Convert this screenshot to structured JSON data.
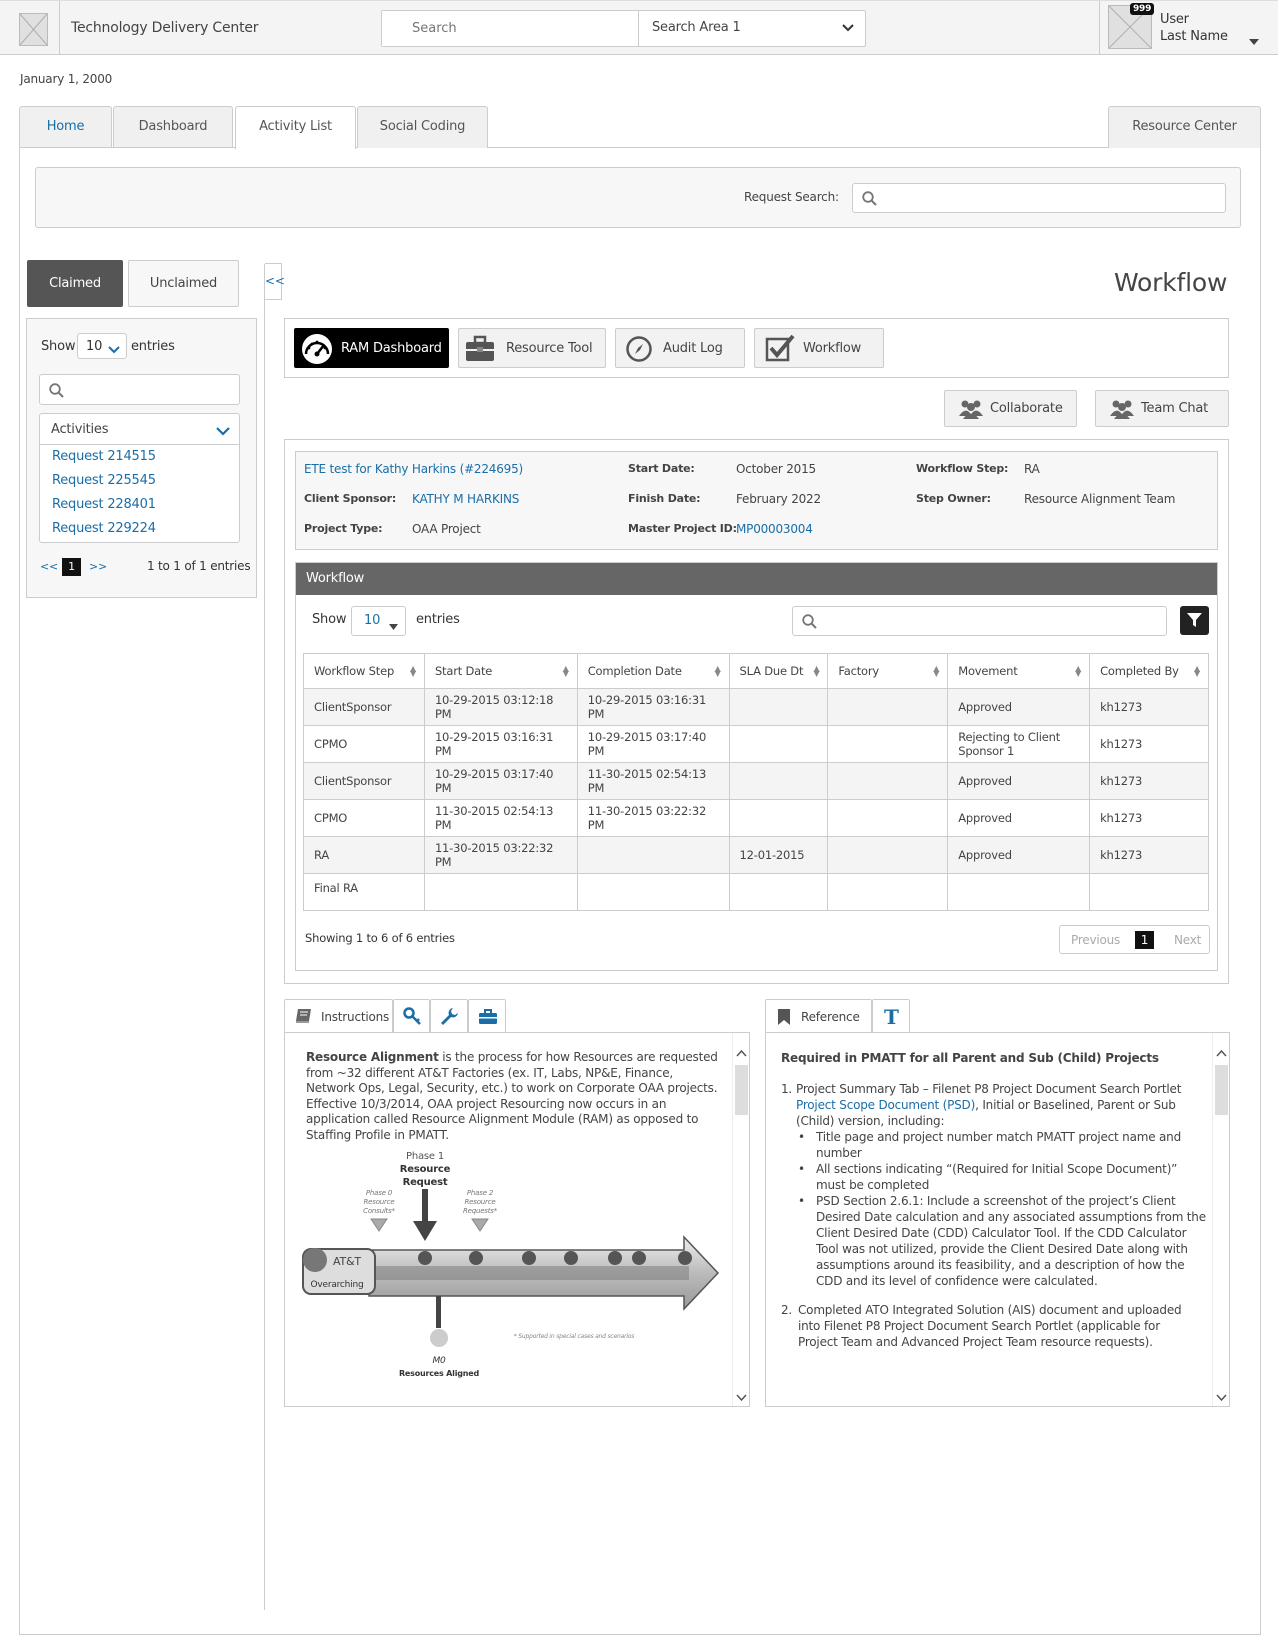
{
  "header": {
    "app_title": "Technology Delivery Center",
    "search_placeholder": "Search",
    "search_area": "Search Area 1",
    "user_first": "User",
    "user_last": "Last Name",
    "notification_count": "999"
  },
  "date": "January 1, 2000",
  "tabs": [
    {
      "label": "Home"
    },
    {
      "label": "Dashboard"
    },
    {
      "label": "Activity List"
    },
    {
      "label": "Social Coding"
    },
    {
      "label": "Resource Center"
    }
  ],
  "request_search_label": "Request Search:",
  "left": {
    "claimed": "Claimed",
    "unclaimed": "Unclaimed",
    "collapse": "<<",
    "show": "Show",
    "show_value": "10",
    "entries": "entries",
    "activities": "Activities",
    "requests": [
      "Request 214515",
      "Request 225545",
      "Request 228401",
      "Request 229224"
    ],
    "pager_prev": "<<",
    "pager_page": "1",
    "pager_next": ">>",
    "pager_info": "1 to 1 of 1 entries"
  },
  "workflow_title": "Workflow",
  "toolbar": {
    "ram": "RAM Dashboard",
    "resource_tool": "Resource Tool",
    "audit_log": "Audit Log",
    "workflow": "Workflow",
    "collaborate": "Collaborate",
    "team_chat": "Team Chat"
  },
  "project": {
    "title_link": "ETE test for Kathy Harkins (#224695)",
    "client_sponsor_label": "Client Sponsor:",
    "client_sponsor": "KATHY M HARKINS",
    "project_type_label": "Project Type:",
    "project_type": "OAA Project",
    "start_label": "Start Date:",
    "start": "October 2015",
    "finish_label": "Finish Date:",
    "finish": "February 2022",
    "master_label": "Master Project ID:",
    "master": "MP00003004",
    "step_label": "Workflow Step:",
    "step": "RA",
    "owner_label": "Step Owner:",
    "owner": "Resource Alignment Team"
  },
  "wf_table": {
    "header": "Workflow",
    "show": "Show",
    "show_value": "10",
    "entries": "entries",
    "columns": [
      "Workflow Step",
      "Start Date",
      "Completion Date",
      "SLA Due Dt",
      "Factory",
      "Movement",
      "Completed By"
    ],
    "rows": [
      [
        "ClientSponsor",
        "10-29-2015 03:12:18 PM",
        "10-29-2015 03:16:31 PM",
        "",
        "",
        "Approved",
        "kh1273"
      ],
      [
        "CPMO",
        "10-29-2015 03:16:31 PM",
        "10-29-2015 03:17:40 PM",
        "",
        "",
        "Rejecting to Client Sponsor 1",
        "kh1273"
      ],
      [
        "ClientSponsor",
        "10-29-2015 03:17:40 PM",
        "11-30-2015 02:54:13 PM",
        "",
        "",
        "Approved",
        "kh1273"
      ],
      [
        "CPMO",
        "11-30-2015 02:54:13 PM",
        "11-30-2015 03:22:32 PM",
        "",
        "",
        "Approved",
        "kh1273"
      ],
      [
        "RA",
        "11-30-2015 03:22:32 PM",
        "",
        "12-01-2015",
        "",
        "Approved",
        "kh1273"
      ],
      [
        "Final RA",
        "",
        "",
        "",
        "",
        "",
        ""
      ]
    ],
    "showing": "Showing 1 to 6 of 6 entries",
    "previous": "Previous",
    "page": "1",
    "next": "Next"
  },
  "instructions": {
    "tab": "Instructions",
    "bold": "Resource Alignment",
    "text": " is the process for how Resources are requested from ~32 different AT&T Factories (ex. IT, Labs, NP&E, Finance, Network Ops, Legal, Security, etc.) to work on Corporate OAA projects. Effective 10/3/2014, OAA project Resourcing now occurs in an application called Resource Alignment Module (RAM) as opposed to Staffing Profile in PMATT.",
    "diagram": {
      "phase1_a": "Phase 1",
      "phase1_b": "Resource",
      "phase1_c": "Request",
      "phase0_a": "Phase 0",
      "phase0_b": "Resource",
      "phase0_c": "Consults*",
      "phase2_a": "Phase 2",
      "phase2_b": "Resource",
      "phase2_c": "Requests*",
      "logo_text": "AT&T",
      "logo_sub": "Overarching",
      "m0": "M0",
      "aligned": "Resources Aligned",
      "footnote": "* Supported in special cases and scenarios"
    }
  },
  "reference": {
    "tab": "Reference",
    "heading": "Required in PMATT for all Parent and Sub (Child) Projects",
    "item1_num": "1.",
    "item1_a": "Project Summary Tab – Filenet P8 Project Document Search Portlet",
    "item1_link": "Project Scope Document (PSD)",
    "item1_b": ", Initial or Baselined, Parent or Sub (Child) version, including:",
    "bullets": [
      "Title page and project number match PMATT project name and number",
      "All sections indicating “(Required for Initial Scope Document)” must be completed",
      "PSD Section 2.6.1: Include a screenshot of the project’s Client Desired Date calculation and any associated assumptions from the Client Desired Date (CDD) Calculator Tool. If the CDD Calculator Tool was not utilized, provide the Client Desired Date along with assumptions around its feasibility, and a description of how the CDD and its level of confidence were calculated."
    ],
    "item2_num": "2.",
    "item2": "Completed ATO Integrated Solution (AIS) document and uploaded into Filenet P8 Project Document Search Portlet (applicable for Project Team and Advanced Project Team resource requests)."
  }
}
